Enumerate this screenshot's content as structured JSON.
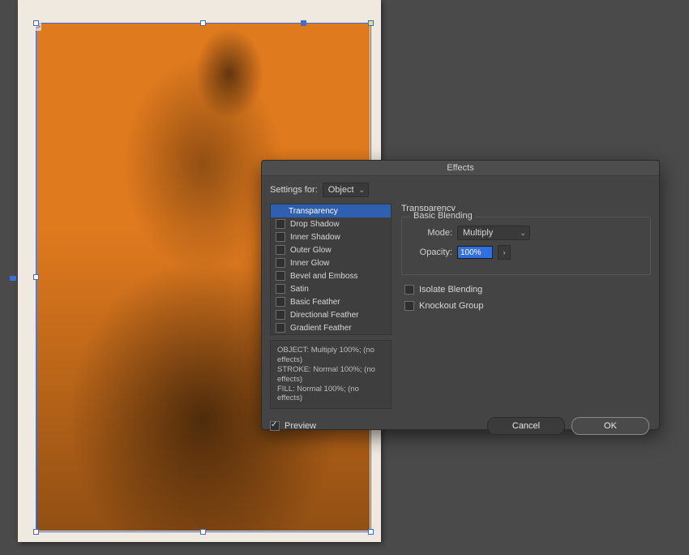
{
  "dialog": {
    "title": "Effects",
    "settings_for_label": "Settings for:",
    "settings_for_value": "Object",
    "right_heading": "Transparency",
    "basic_blending_legend": "Basic Blending",
    "mode_label": "Mode:",
    "mode_value": "Multiply",
    "opacity_label": "Opacity:",
    "opacity_value": "100%",
    "isolate_label": "Isolate Blending",
    "knockout_label": "Knockout Group",
    "preview_label": "Preview",
    "cancel_label": "Cancel",
    "ok_label": "OK"
  },
  "effects": [
    {
      "label": "Transparency",
      "checked": false,
      "selected": true,
      "has_checkbox": false
    },
    {
      "label": "Drop Shadow",
      "checked": false,
      "selected": false,
      "has_checkbox": true
    },
    {
      "label": "Inner Shadow",
      "checked": false,
      "selected": false,
      "has_checkbox": true
    },
    {
      "label": "Outer Glow",
      "checked": false,
      "selected": false,
      "has_checkbox": true
    },
    {
      "label": "Inner Glow",
      "checked": false,
      "selected": false,
      "has_checkbox": true
    },
    {
      "label": "Bevel and Emboss",
      "checked": false,
      "selected": false,
      "has_checkbox": true
    },
    {
      "label": "Satin",
      "checked": false,
      "selected": false,
      "has_checkbox": true
    },
    {
      "label": "Basic Feather",
      "checked": false,
      "selected": false,
      "has_checkbox": true
    },
    {
      "label": "Directional Feather",
      "checked": false,
      "selected": false,
      "has_checkbox": true
    },
    {
      "label": "Gradient Feather",
      "checked": false,
      "selected": false,
      "has_checkbox": true
    }
  ],
  "summary": {
    "line1": "OBJECT: Multiply 100%; (no effects)",
    "line2": "STROKE: Normal 100%; (no effects)",
    "line3": "FILL: Normal 100%; (no effects)"
  },
  "state": {
    "preview_checked": true,
    "isolate_checked": false,
    "knockout_checked": false
  },
  "colors": {
    "accent": "#2f5fb0",
    "dialog_bg": "#444444",
    "canvas_bg": "#4a4a4a",
    "image_tint": "#e07a1e"
  }
}
